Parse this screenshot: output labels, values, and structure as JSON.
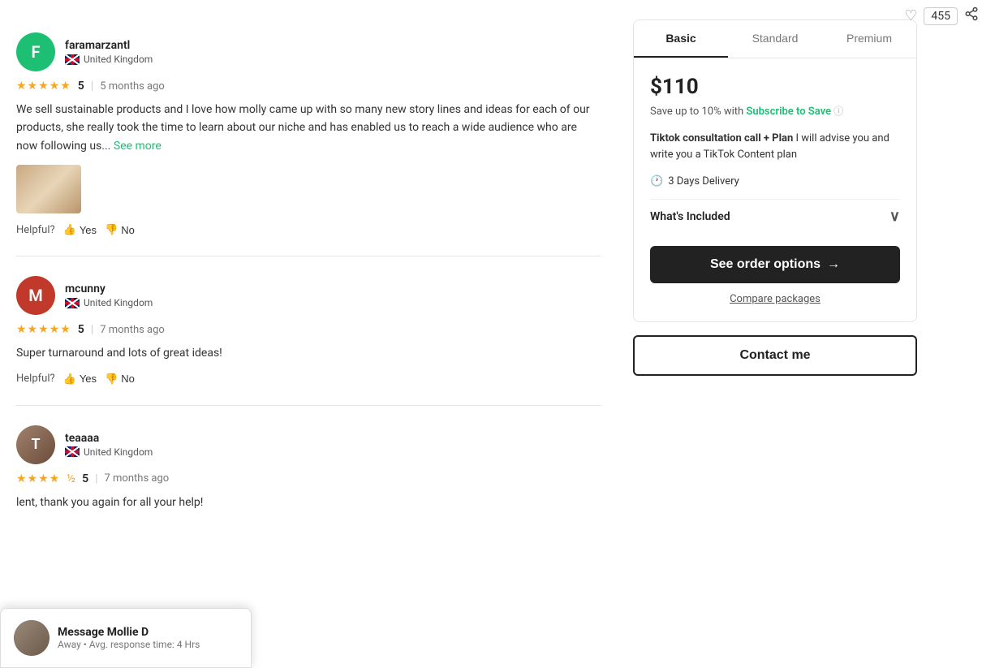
{
  "topbar": {
    "likes_count": "455",
    "heart_icon": "♡",
    "share_icon": "⬆"
  },
  "reviews": [
    {
      "id": "review-1",
      "avatar_letter": "F",
      "avatar_class": "avatar-f",
      "username": "faramarzantl",
      "location": "United Kingdom",
      "rating": "5",
      "stars": "★★★★★",
      "time_ago": "5 months ago",
      "text": "We sell sustainable products and I love how molly came up with so many new story lines and ideas for each of our products, she really took the time to learn about our niche and has enabled us to reach a wide audience who are now following us...",
      "see_more": "See more",
      "has_image": true,
      "helpful_label": "Helpful?",
      "yes_label": "Yes",
      "no_label": "No"
    },
    {
      "id": "review-2",
      "avatar_letter": "M",
      "avatar_class": "avatar-m",
      "username": "mcunny",
      "location": "United Kingdom",
      "rating": "5",
      "stars": "★★★★★",
      "time_ago": "7 months ago",
      "text": "Super turnaround and lots of great ideas!",
      "has_image": false,
      "helpful_label": "Helpful?",
      "yes_label": "Yes",
      "no_label": "No"
    },
    {
      "id": "review-3",
      "avatar_letter": "T",
      "avatar_class": "avatar-t",
      "username": "teaaaa",
      "location": "United Kingdom",
      "rating": "5",
      "stars": "★★★★",
      "half_star": "½",
      "time_ago": "7 months ago",
      "text": "lent, thank you again for all your help!",
      "has_image": false,
      "has_photo": true,
      "helpful_label": "Helpful?",
      "yes_label": "Yes",
      "no_label": "No"
    }
  ],
  "package": {
    "tabs": [
      {
        "id": "basic",
        "label": "Basic",
        "active": true
      },
      {
        "id": "standard",
        "label": "Standard",
        "active": false
      },
      {
        "id": "premium",
        "label": "Premium",
        "active": false
      }
    ],
    "price": "$110",
    "save_text": "Save up to 10% with",
    "subscribe_label": "Subscribe to Save",
    "info_icon": "ⓘ",
    "description_bold": "Tiktok consultation call + Plan",
    "description_rest": " I will advise you and write you a TikTok Content plan",
    "delivery_icon": "🕐",
    "delivery_text": "3 Days Delivery",
    "whats_included": "What's Included",
    "chevron": "∨",
    "order_button": "See order options",
    "arrow": "→",
    "compare_label": "Compare packages",
    "contact_button": "Contact me"
  },
  "message_popup": {
    "name": "Message Mollie D",
    "status": "Away",
    "response_time": "Avg. response time: 4 Hrs"
  }
}
